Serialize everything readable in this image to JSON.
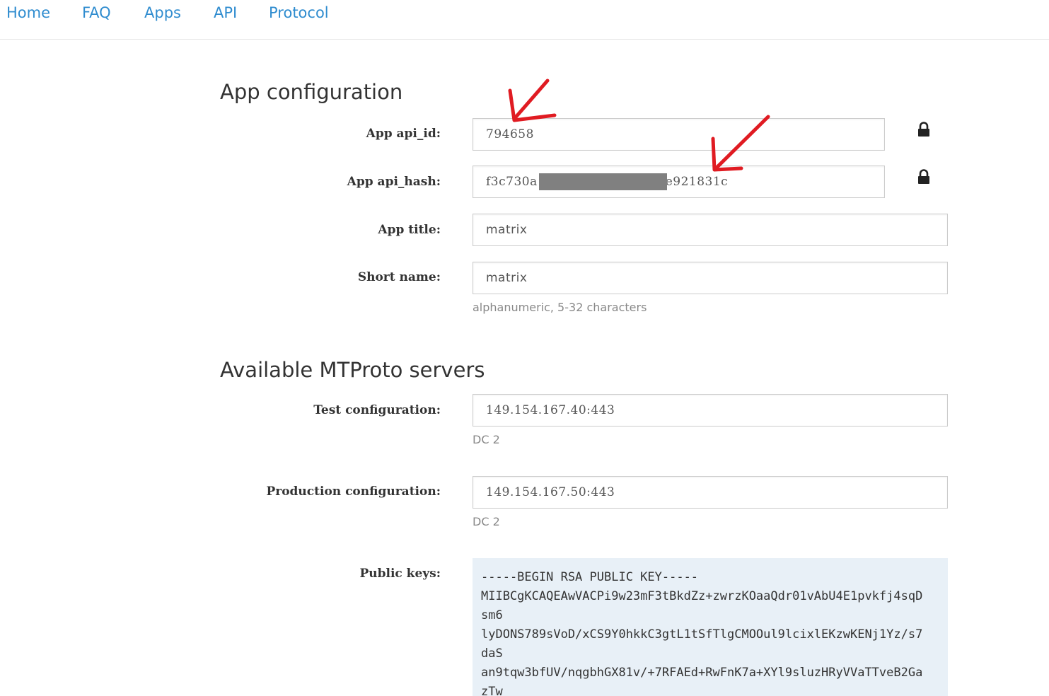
{
  "nav": {
    "items": [
      {
        "label": "Home"
      },
      {
        "label": "FAQ"
      },
      {
        "label": "Apps"
      },
      {
        "label": "API"
      },
      {
        "label": "Protocol"
      }
    ]
  },
  "app_config": {
    "title": "App configuration",
    "api_id": {
      "label": "App api_id:",
      "value": "794658",
      "icon": "lock-icon"
    },
    "api_hash": {
      "label": "App api_hash:",
      "value_start": "f3c730a",
      "value_end": "e921831c",
      "redacted": true,
      "icon": "lock-icon"
    },
    "app_title": {
      "label": "App title:",
      "value": "matrix"
    },
    "short_name": {
      "label": "Short name:",
      "value": "matrix",
      "help": "alphanumeric, 5-32 characters"
    }
  },
  "servers": {
    "title": "Available MTProto servers",
    "test": {
      "label": "Test configuration:",
      "value": "149.154.167.40:443",
      "dc": "DC 2"
    },
    "production": {
      "label": "Production configuration:",
      "value": "149.154.167.50:443",
      "dc": "DC 2"
    },
    "public_keys": {
      "label": "Public keys:",
      "lines": [
        "-----BEGIN RSA PUBLIC KEY-----",
        "MIIBCgKCAQEAwVACPi9w23mF3tBkdZz+zwrzKOaaQdr01vAbU4E1pvkfj4sqD",
        "sm6",
        "lyDONS789sVoD/xCS9Y0hkkC3gtL1tSfTlgCMOOul9lcixlEKzwKENj1Yz/s7",
        "daS",
        "an9tqw3bfUV/nqgbhGX81v/+7RFAEd+RwFnK7a+XYl9sluzHRyVVaTTveB2Ga",
        "zTw"
      ]
    }
  },
  "annotation_color": "#e01b22",
  "link_color": "#2f8ccf"
}
